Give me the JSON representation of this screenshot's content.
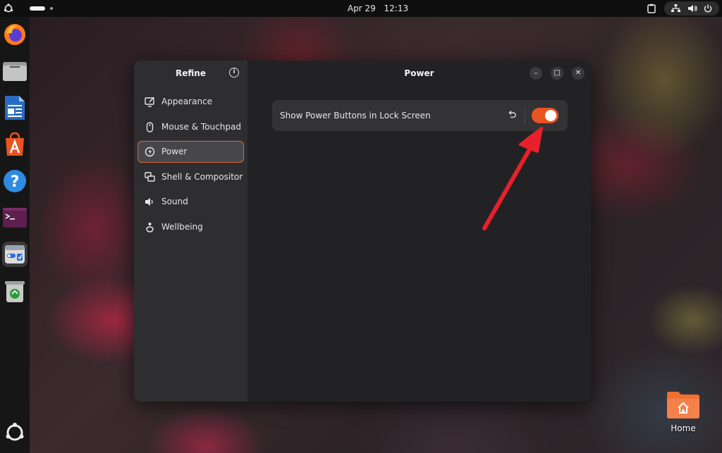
{
  "topbar": {
    "date": "Apr 29",
    "time": "12:13",
    "icons": [
      "ubuntu-logo-icon",
      "clipboard-icon",
      "network-icon",
      "volume-icon",
      "power-icon"
    ]
  },
  "dock": {
    "items": [
      "firefox-icon",
      "files-icon",
      "libreoffice-writer-icon",
      "app-center-icon",
      "help-icon",
      "terminal-icon",
      "refine-app-icon",
      "trash-icon",
      "show-apps-icon"
    ]
  },
  "window": {
    "sidebar_title": "Refine",
    "content_title": "Power",
    "nav": [
      {
        "label": "Appearance",
        "icon": "appearance-icon"
      },
      {
        "label": "Mouse & Touchpad",
        "icon": "mouse-icon"
      },
      {
        "label": "Power",
        "icon": "power-bolt-icon",
        "selected": true
      },
      {
        "label": "Shell & Compositor",
        "icon": "windows-icon"
      },
      {
        "label": "Sound",
        "icon": "speaker-icon"
      },
      {
        "label": "Wellbeing",
        "icon": "wellbeing-icon"
      }
    ],
    "setting": {
      "label": "Show Power Buttons in Lock Screen",
      "enabled": true
    },
    "controls": {
      "minimize": "–",
      "maximize": "□",
      "close": "✕",
      "info": "i"
    }
  },
  "desktop": {
    "home_label": "Home"
  },
  "colors": {
    "accent": "#e95420",
    "selection_border": "#d5683a",
    "annotation_arrow": "#e8202a"
  }
}
